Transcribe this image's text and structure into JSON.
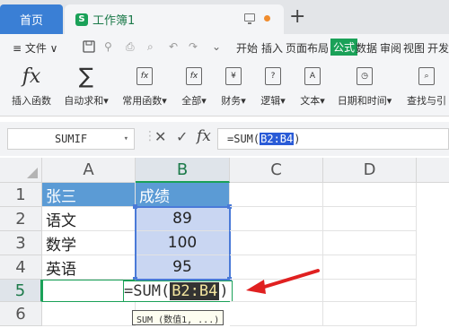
{
  "tabs": {
    "home": "首页",
    "doc_logo": "S",
    "doc_title": "工作簿1"
  },
  "menu": {
    "file": "≡ 文件 ∨",
    "items": [
      "开始",
      "插入",
      "页面布局",
      "公式",
      "数据",
      "审阅",
      "视图",
      "开发"
    ],
    "active": "公式"
  },
  "ribbon": [
    {
      "label": "插入函数",
      "icon": "fx-icon"
    },
    {
      "label": "自动求和▾",
      "icon": "sigma-icon"
    },
    {
      "label": "常用函数▾",
      "icon": "common-function-icon"
    },
    {
      "label": "全部▾",
      "icon": "all-function-icon"
    },
    {
      "label": "财务▾",
      "icon": "finance-icon"
    },
    {
      "label": "逻辑▾",
      "icon": "logic-icon"
    },
    {
      "label": "文本▾",
      "icon": "text-icon"
    },
    {
      "label": "日期和时间▾",
      "icon": "datetime-icon"
    },
    {
      "label": "查找与引",
      "icon": "lookup-icon"
    }
  ],
  "formula_bar": {
    "name_box": "SUMIF",
    "formula_prefix": "=SUM(",
    "formula_ref": "B2:B4",
    "formula_suffix": ")",
    "fx": "fx"
  },
  "columns": [
    "A",
    "B",
    "C",
    "D"
  ],
  "rows": [
    "1",
    "2",
    "3",
    "4",
    "5",
    "6"
  ],
  "cells": {
    "A1": "张三",
    "B1": "成绩",
    "A2": "语文",
    "B2": "89",
    "A3": "数学",
    "B3": "100",
    "A4": "英语",
    "B4": "95",
    "B5_prefix": "=SUM(",
    "B5_ref": "B2:B4",
    "B5_suffix": ")"
  },
  "tooltip": "SUM (数值1, ...)",
  "colors": {
    "accent": "#1aa158",
    "header_fill": "#5b9bd5",
    "selection": "#c9d6f2",
    "arrow": "#e02020"
  }
}
